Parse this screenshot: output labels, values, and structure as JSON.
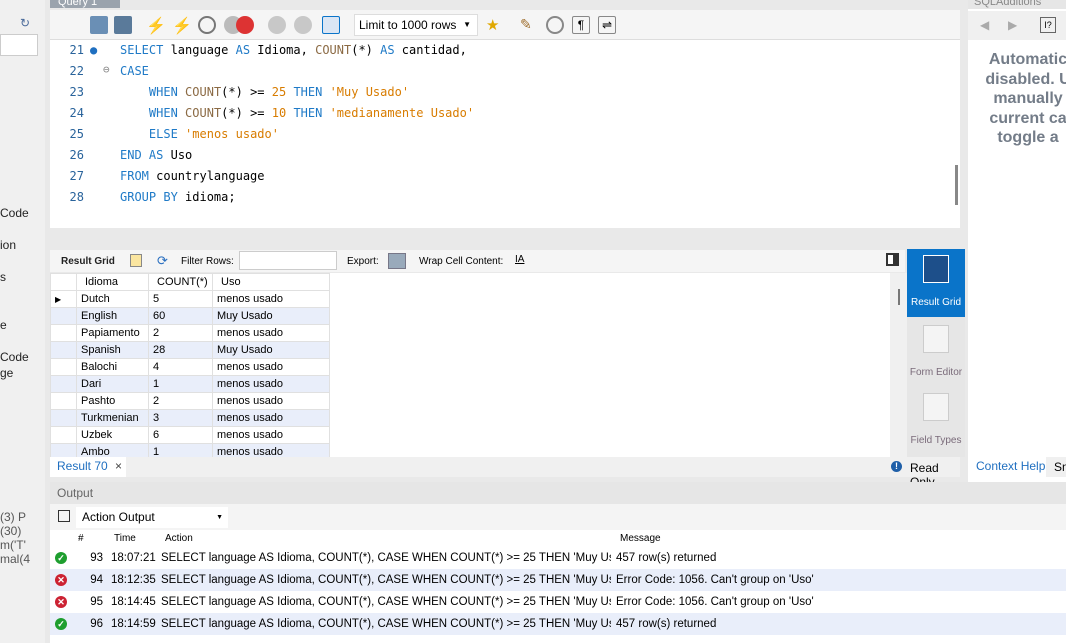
{
  "sidebar": {
    "fragments": [
      "Code",
      "ion",
      "s",
      "e",
      "Code",
      "ge",
      "(3) P",
      "(30)",
      "m('T'",
      "mal(4"
    ]
  },
  "editor_tab": {
    "label": "Query 1"
  },
  "toolbar": {
    "limit": "Limit to 1000 rows"
  },
  "editor": {
    "lines": [
      {
        "n": "21",
        "text": "SELECT language AS Idioma, COUNT(*) AS cantidad,"
      },
      {
        "n": "22",
        "text": "CASE"
      },
      {
        "n": "23",
        "text": "    WHEN COUNT(*) >= 25 THEN 'Muy Usado'"
      },
      {
        "n": "24",
        "text": "    WHEN COUNT(*) >= 10 THEN 'medianamente Usado'"
      },
      {
        "n": "25",
        "text": "    ELSE 'menos usado'"
      },
      {
        "n": "26",
        "text": "END AS Uso"
      },
      {
        "n": "27",
        "text": "FROM countrylanguage"
      },
      {
        "n": "28",
        "text": "GROUP BY idioma;"
      }
    ]
  },
  "result_toolbar": {
    "result_grid": "Result Grid",
    "filter_rows": "Filter Rows:",
    "filter_value": "",
    "export": "Export:",
    "wrap": "Wrap Cell Content:"
  },
  "grid": {
    "columns": [
      "Idioma",
      "COUNT(*)",
      "Uso"
    ],
    "rows": [
      [
        "Dutch",
        "5",
        "menos usado"
      ],
      [
        "English",
        "60",
        "Muy Usado"
      ],
      [
        "Papiamento",
        "2",
        "menos usado"
      ],
      [
        "Spanish",
        "28",
        "Muy Usado"
      ],
      [
        "Balochi",
        "4",
        "menos usado"
      ],
      [
        "Dari",
        "1",
        "menos usado"
      ],
      [
        "Pashto",
        "2",
        "menos usado"
      ],
      [
        "Turkmenian",
        "3",
        "menos usado"
      ],
      [
        "Uzbek",
        "6",
        "menos usado"
      ],
      [
        "Ambo",
        "1",
        "menos usado"
      ]
    ]
  },
  "side_buttons": [
    {
      "label": "Result Grid",
      "active": true
    },
    {
      "label": "Form Editor"
    },
    {
      "label": "Field Types"
    }
  ],
  "result_tab": {
    "label": "Result 70",
    "read_only": "Read Only"
  },
  "right_panel": {
    "title": "SQLAdditions",
    "text": [
      "Automatic",
      "disabled. U",
      "manually",
      "current ca",
      "toggle a"
    ],
    "tabs": [
      "Context Help",
      "Sn"
    ]
  },
  "output": {
    "title": "Output",
    "mode": "Action Output",
    "columns": [
      "#",
      "Time",
      "Action",
      "Message"
    ],
    "rows": [
      {
        "status": "ok",
        "n": "93",
        "time": "18:07:21",
        "action": "SELECT language AS Idioma, COUNT(*),  CASE WHEN COUNT(*) >= 25 THEN 'Muy Usad...",
        "message": "457 row(s) returned"
      },
      {
        "status": "error",
        "n": "94",
        "time": "18:12:35",
        "action": "SELECT language AS Idioma, COUNT(*),  CASE WHEN COUNT(*) >= 25 THEN 'Muy Usad...",
        "message": "Error Code: 1056. Can't group on 'Uso'"
      },
      {
        "status": "error",
        "n": "95",
        "time": "18:14:45",
        "action": "SELECT language AS Idioma, COUNT(*),  CASE WHEN COUNT(*) >= 25 THEN 'Muy Usad...",
        "message": "Error Code: 1056. Can't group on 'Uso'"
      },
      {
        "status": "ok",
        "n": "96",
        "time": "18:14:59",
        "action": "SELECT language AS Idioma, COUNT(*),  CASE WHEN COUNT(*) >= 25 THEN 'Muy Usad...",
        "message": "457 row(s) returned"
      }
    ]
  },
  "colors": {
    "accent": "#0a74c9",
    "ok": "#1e9e2f",
    "error": "#cc2233",
    "alt_row": "#e9eefa"
  }
}
